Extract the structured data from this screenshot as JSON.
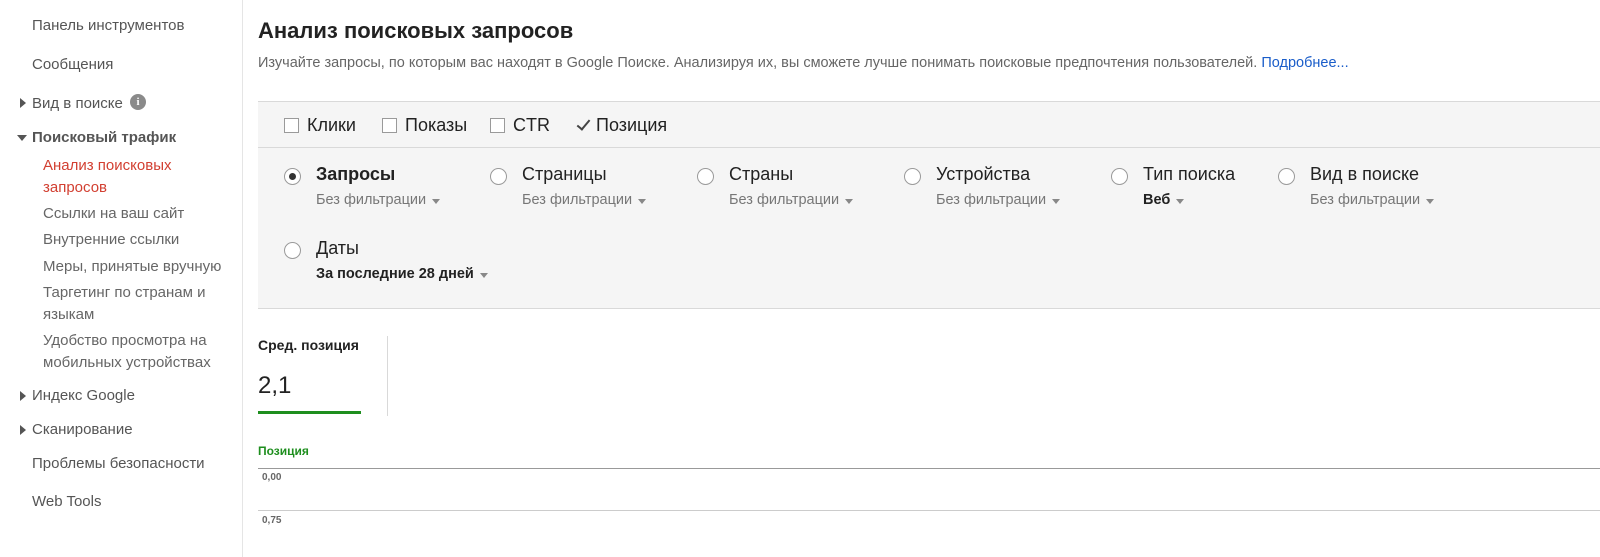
{
  "sidebar": {
    "dashboard": "Панель инструментов",
    "messages": "Сообщения",
    "search_appearance": "Вид в поиске",
    "search_traffic": "Поисковый трафик",
    "traffic_items": [
      "Анализ поисковых запросов",
      "Ссылки на ваш сайт",
      "Внутренние ссылки",
      "Меры, принятые вручную",
      "Таргетинг по странам и языкам",
      "Удобство просмотра на мобильных устройствах"
    ],
    "google_index": "Индекс Google",
    "crawl": "Сканирование",
    "security_issues": "Проблемы безопасности",
    "web_tools": "Web Tools",
    "info_icon": "info-icon"
  },
  "main": {
    "title": "Анализ поисковых запросов",
    "description": "Изучайте запросы, по которым вас находят в Google Поиске. Анализируя их, вы сможете лучше понимать поисковые предпочтения пользователей.",
    "more_link": "Подробнее..."
  },
  "metrics": [
    {
      "label": "Клики",
      "checked": false
    },
    {
      "label": "Показы",
      "checked": false
    },
    {
      "label": "CTR",
      "checked": false
    },
    {
      "label": "Позиция",
      "checked": true
    }
  ],
  "dimensions": [
    {
      "label": "Запросы",
      "filter": "Без фильтрации",
      "selected": true
    },
    {
      "label": "Страницы",
      "filter": "Без фильтрации",
      "selected": false
    },
    {
      "label": "Страны",
      "filter": "Без фильтрации",
      "selected": false
    },
    {
      "label": "Устройства",
      "filter": "Без фильтрации",
      "selected": false
    },
    {
      "label": "Тип поиска",
      "filter": "Веб",
      "selected": false
    },
    {
      "label": "Вид в поиске",
      "filter": "Без фильтрации",
      "selected": false
    },
    {
      "label": "Даты",
      "filter": "За последние 28 дней",
      "selected": false
    }
  ],
  "summary": {
    "label": "Сред. позиция",
    "value": "2,1",
    "accent_color": "#1e8e1e"
  },
  "chart": {
    "series_label": "Позиция",
    "ticks": [
      "0,00",
      "0,75"
    ]
  }
}
